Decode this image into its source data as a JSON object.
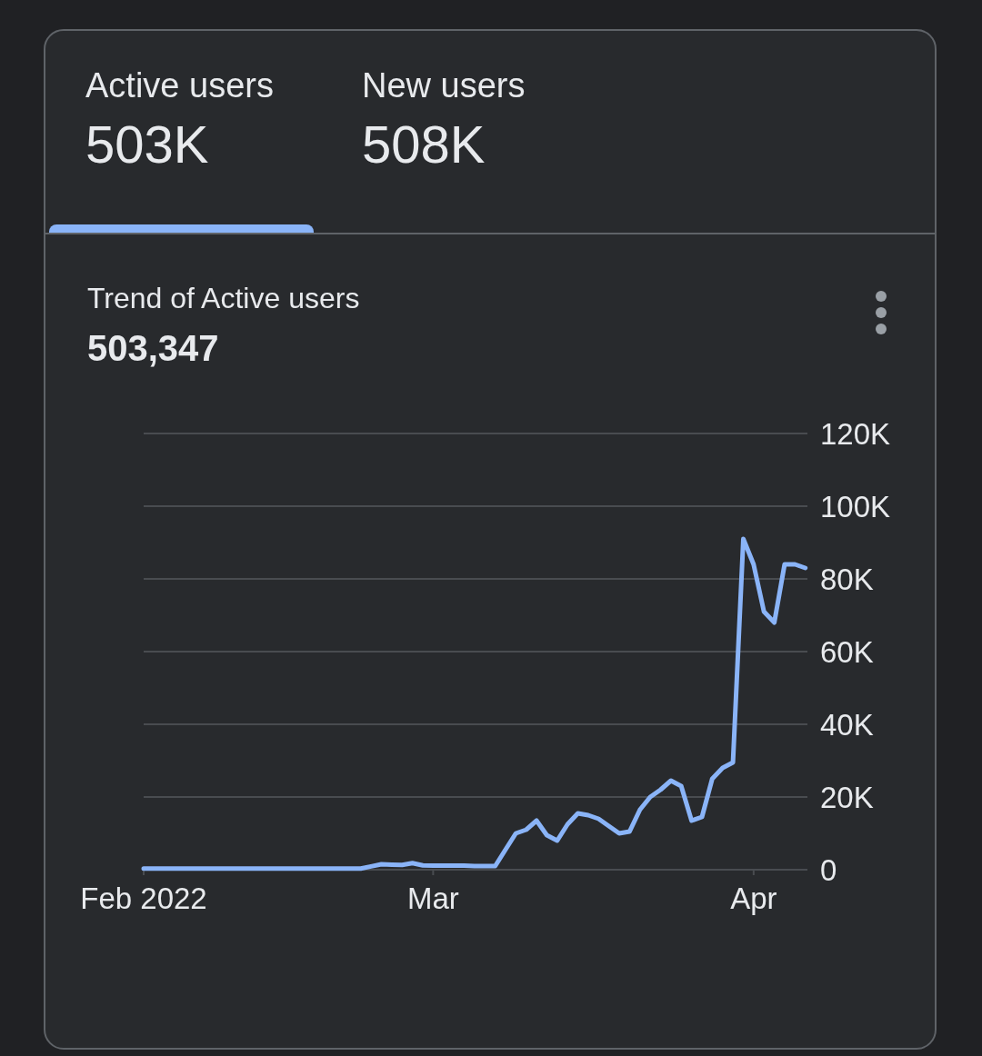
{
  "tabs": [
    {
      "label": "Active users",
      "value": "503K",
      "selected": true
    },
    {
      "label": "New users",
      "value": "508K",
      "selected": false
    }
  ],
  "card": {
    "title": "Trend of Active users",
    "total": "503,347",
    "chart_data": {
      "type": "line",
      "categories": [
        "Feb 2022",
        null,
        null,
        null,
        null,
        null,
        null,
        null,
        null,
        null,
        null,
        null,
        null,
        null,
        null,
        null,
        null,
        null,
        null,
        null,
        null,
        null,
        null,
        null,
        null,
        null,
        null,
        null,
        "Mar",
        null,
        null,
        null,
        null,
        null,
        null,
        null,
        null,
        null,
        null,
        null,
        null,
        null,
        null,
        null,
        null,
        null,
        null,
        null,
        null,
        null,
        null,
        null,
        null,
        null,
        null,
        null,
        null,
        null,
        null,
        "Apr",
        null,
        null,
        null,
        null,
        null
      ],
      "series": [
        {
          "color": "#8ab4f8",
          "values": [
            300,
            300,
            300,
            300,
            300,
            300,
            300,
            300,
            300,
            300,
            300,
            300,
            300,
            300,
            300,
            300,
            300,
            300,
            300,
            300,
            300,
            300,
            900,
            1500,
            1400,
            1300,
            1800,
            1200,
            1100,
            1100,
            1100,
            1100,
            1000,
            1000,
            1000,
            5500,
            10000,
            11000,
            13500,
            9500,
            8000,
            12500,
            15500,
            15000,
            14000,
            12000,
            10000,
            10500,
            16500,
            20000,
            22000,
            24500,
            23000,
            13500,
            14500,
            25000,
            28000,
            29500,
            91000,
            84000,
            71000,
            68000,
            84000,
            84000,
            83000
          ]
        }
      ],
      "ylim": [
        0,
        120000
      ],
      "grid": true,
      "yticks": [
        {
          "value": 0,
          "label": "0"
        },
        {
          "value": 20000,
          "label": "20K"
        },
        {
          "value": 40000,
          "label": "40K"
        },
        {
          "value": 60000,
          "label": "60K"
        },
        {
          "value": 80000,
          "label": "80K"
        },
        {
          "value": 100000,
          "label": "100K"
        },
        {
          "value": 120000,
          "label": "120K"
        }
      ]
    }
  }
}
